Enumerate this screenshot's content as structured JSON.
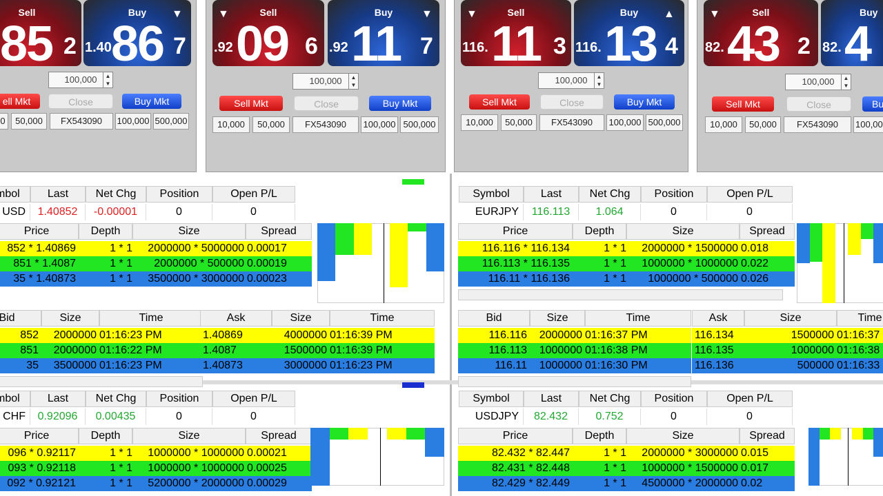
{
  "colors": {
    "yellow": "#ffff00",
    "green": "#22e622",
    "blue": "#2a7de1",
    "sell_red": "#d0202c",
    "buy_blue": "#2d66d8",
    "up_green": "#22a830",
    "down_red": "#e02020"
  },
  "panels": [
    {
      "sell_label": "Sell",
      "sell_big": "85",
      "sell_small": "2",
      "buy_label": "Buy",
      "buy_prefix": "1.40",
      "buy_big": "86",
      "buy_small": "7",
      "buy_arrow": "▼",
      "amount": "100,000",
      "sell_mkt": "ell Mkt",
      "close": "Close",
      "buy_mkt": "Buy Mkt",
      "q0": "0",
      "q1": "50,000",
      "account": "FX543090",
      "q2": "100,000",
      "q3": "500,000"
    },
    {
      "sell_label": "Sell",
      "sell_arrow": "▼",
      "sell_prefix": ".92",
      "sell_big": "09",
      "sell_small": "6",
      "buy_label": "Buy",
      "buy_arrow": "▼",
      "buy_prefix": ".92",
      "buy_big": "11",
      "buy_small": "7",
      "amount": "100,000",
      "sell_mkt": "Sell Mkt",
      "close": "Close",
      "buy_mkt": "Buy Mkt",
      "q0": "10,000",
      "q1": "50,000",
      "account": "FX543090",
      "q2": "100,000",
      "q3": "500,000"
    },
    {
      "sell_label": "Sell",
      "sell_arrow": "▼",
      "sell_prefix": "116.",
      "sell_big": "11",
      "sell_small": "3",
      "buy_label": "Buy",
      "buy_arrow": "▲",
      "buy_prefix": "116.",
      "buy_big": "13",
      "buy_small": "4",
      "amount": "100,000",
      "sell_mkt": "Sell Mkt",
      "close": "Close",
      "buy_mkt": "Buy Mkt",
      "q0": "10,000",
      "q1": "50,000",
      "account": "FX543090",
      "q2": "100,000",
      "q3": "500,000"
    },
    {
      "sell_label": "Sell",
      "sell_arrow": "▼",
      "sell_prefix": "82.",
      "sell_big": "43",
      "sell_small": "2",
      "buy_label": "Buy",
      "buy_prefix": "82.",
      "buy_big": "4",
      "amount": "100,000",
      "sell_mkt": "Sell Mkt",
      "close": "Close",
      "buy_mkt": "Bu",
      "q0": "10,000",
      "q1": "50,000",
      "account": "FX543090",
      "q2": "100,00"
    }
  ],
  "quote_headers": [
    "Symbol",
    "Last",
    "Net Chg",
    "Position",
    "Open P/L"
  ],
  "book_headers": [
    "Price",
    "Depth",
    "Size",
    "Spread"
  ],
  "trade_headers": {
    "bid": [
      "Bid",
      "Size",
      "Time"
    ],
    "ask": [
      "Ask",
      "Size",
      "Time"
    ]
  },
  "blocks": [
    {
      "id": "gbpusd",
      "quote": {
        "symbol": "USD",
        "last": "1.40852",
        "net_chg": "-0.00001",
        "position": "0",
        "open_pl": "0",
        "direction": "down"
      },
      "book": [
        {
          "price": "852 * 1.40869",
          "depth": "1 * 1",
          "size": "2000000 * 5000000",
          "spread": "0.00017"
        },
        {
          "price": "851 * 1.4087",
          "depth": "1 * 1",
          "size": "2000000 * 500000",
          "spread": "0.00019"
        },
        {
          "price": "35 * 1.40873",
          "depth": "1 * 1",
          "size": "3500000 * 3000000",
          "spread": "0.00023"
        }
      ],
      "bids": [
        {
          "v": "852",
          "s": "2000000",
          "t": "01:16:23 PM"
        },
        {
          "v": "851",
          "s": "2000000",
          "t": "01:16:22 PM"
        },
        {
          "v": "35",
          "s": "3500000",
          "t": "01:16:23 PM"
        }
      ],
      "asks": [
        {
          "v": "1.40869",
          "s": "4000000",
          "t": "01:16:39 PM"
        },
        {
          "v": "1.4087",
          "s": "1500000",
          "t": "01:16:39 PM"
        },
        {
          "v": "1.40873",
          "s": "3000000",
          "t": "01:16:23 PM"
        }
      ]
    },
    {
      "id": "eurjpy",
      "quote": {
        "symbol": "EURJPY",
        "last": "116.113",
        "net_chg": "1.064",
        "position": "0",
        "open_pl": "0",
        "direction": "up"
      },
      "book": [
        {
          "price": "116.116 * 116.134",
          "depth": "1 * 1",
          "size": "2000000 * 1500000",
          "spread": "0.018"
        },
        {
          "price": "116.113 * 116.135",
          "depth": "1 * 1",
          "size": "1000000 * 1000000",
          "spread": "0.022"
        },
        {
          "price": "116.11 * 116.136",
          "depth": "1 * 1",
          "size": "1000000 * 500000",
          "spread": "0.026"
        }
      ],
      "bids": [
        {
          "v": "116.116",
          "s": "2000000",
          "t": "01:16:37 PM"
        },
        {
          "v": "116.113",
          "s": "1000000",
          "t": "01:16:38 PM"
        },
        {
          "v": "116.11",
          "s": "1000000",
          "t": "01:16:30 PM"
        }
      ],
      "asks": [
        {
          "v": "116.134",
          "s": "1500000",
          "t": "01:16:37 P"
        },
        {
          "v": "116.135",
          "s": "1000000",
          "t": "01:16:38 F"
        },
        {
          "v": "116.136",
          "s": "500000",
          "t": "01:16:33 F"
        }
      ]
    },
    {
      "id": "usdchf",
      "quote": {
        "symbol": "CHF",
        "last": "0.92096",
        "net_chg": "0.00435",
        "position": "0",
        "open_pl": "0",
        "direction": "up"
      },
      "book": [
        {
          "price": "096 * 0.92117",
          "depth": "1 * 1",
          "size": "1000000 * 1000000",
          "spread": "0.00021"
        },
        {
          "price": "093 * 0.92118",
          "depth": "1 * 1",
          "size": "1000000 * 1000000",
          "spread": "0.00025"
        },
        {
          "price": "092 * 0.92121",
          "depth": "1 * 1",
          "size": "5200000 * 2000000",
          "spread": "0.00029"
        }
      ]
    },
    {
      "id": "usdjpy",
      "quote": {
        "symbol": "USDJPY",
        "last": "82.432",
        "net_chg": "0.752",
        "position": "0",
        "open_pl": "0",
        "direction": "up"
      },
      "book": [
        {
          "price": "82.432 * 82.447",
          "depth": "1 * 1",
          "size": "2000000 * 3000000",
          "spread": "0.015"
        },
        {
          "price": "82.431 * 82.448",
          "depth": "1 * 1",
          "size": "1000000 * 1500000",
          "spread": "0.017"
        },
        {
          "price": "82.429 * 82.449",
          "depth": "1 * 1",
          "size": "4500000 * 2000000",
          "spread": "0.02"
        }
      ]
    }
  ],
  "scroll_glyph": "III",
  "arrow_left": "◂",
  "arrow_right": "▸"
}
